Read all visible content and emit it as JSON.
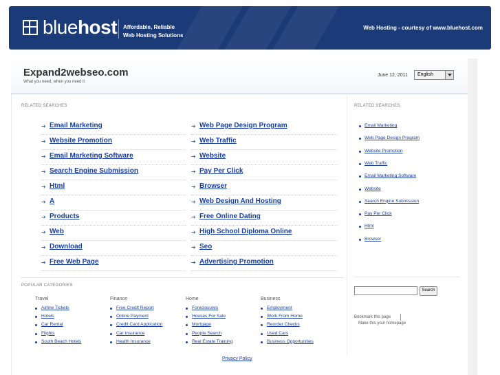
{
  "banner": {
    "brand_light": "blue",
    "brand_bold": "host",
    "tagline_line1": "Affordable, Reliable",
    "tagline_line2": "Web Hosting Solutions",
    "courtesy": "Web Hosting - courtesy of www.bluehost.com",
    "bg_color": "#1b3a78"
  },
  "site": {
    "title": "Expand2webseo.com",
    "subtitle": "What you need, when you need it",
    "date": "June 12, 2011",
    "language": "English"
  },
  "related": {
    "label": "RELATED SEARCHES",
    "left": [
      "Email Marketing",
      "Website Promotion",
      "Email Marketing Software",
      "Search Engine Submission",
      "Html",
      "A",
      "Products",
      "Web",
      "Download",
      "Free Web Page"
    ],
    "right": [
      "Web Page Design Program",
      "Web Traffic",
      "Website",
      "Pay Per Click",
      "Browser",
      "Web Design And Hosting",
      "Free Online Dating",
      "High School Diploma Online",
      "Seo",
      "Advertising Promotion"
    ]
  },
  "sidebar": {
    "label": "RELATED SEARCHES",
    "items": [
      "Email Marketing",
      "Web Page Design Program",
      "Website Promotion",
      "Web Traffic",
      "Email Marketing Software",
      "Website",
      "Search Engine Submission",
      "Pay Per Click",
      "Html",
      "Browser"
    ],
    "search_button": "Search",
    "bookmark": "Bookmark this page",
    "homepage": "Make this your homepage"
  },
  "popular": {
    "label": "POPULAR CATEGORIES",
    "categories": [
      {
        "name": "Travel",
        "links": [
          "Airline Tickets",
          "Hotels",
          "Car Rental",
          "Flights",
          "South Beach Hotels"
        ]
      },
      {
        "name": "Finance",
        "links": [
          "Free Credit Report",
          "Online Payment",
          "Credit Card Application",
          "Car Insurance",
          "Health Insurance"
        ]
      },
      {
        "name": "Home",
        "links": [
          "Foreclosures",
          "Houses For Sale",
          "Mortgage",
          "People Search",
          "Real Estate Training"
        ]
      },
      {
        "name": "Business",
        "links": [
          "Employment",
          "Work From Home",
          "Reorder Checks",
          "Used Cars",
          "Business Opportunities"
        ]
      }
    ]
  },
  "footer": {
    "privacy": "Privacy Policy"
  }
}
